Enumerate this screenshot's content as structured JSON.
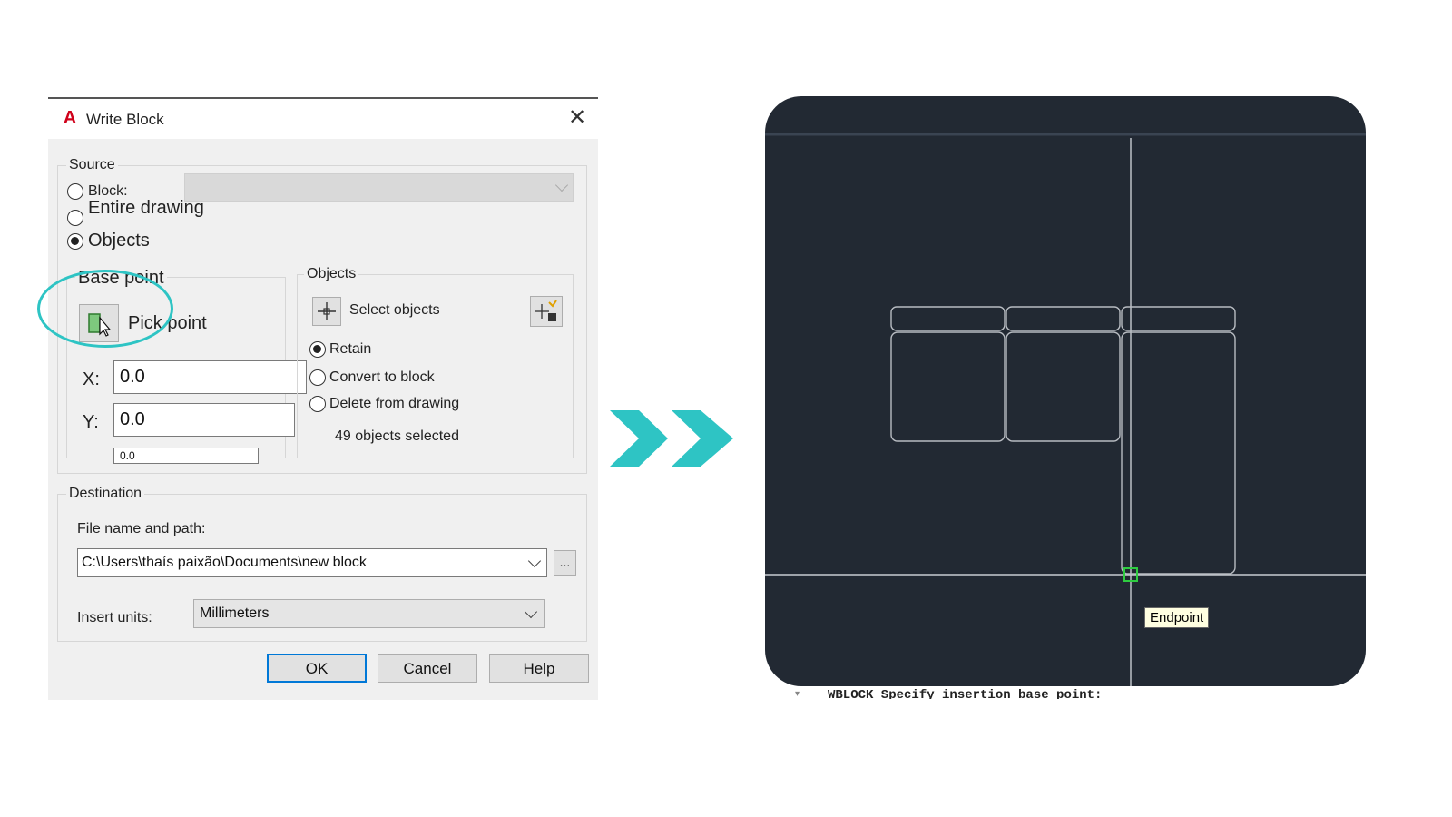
{
  "dialog": {
    "title": "Write Block",
    "close_glyph": "✕",
    "source": {
      "legend": "Source",
      "block_label": "Block:",
      "entire_label": "Entire drawing",
      "objects_label": "Objects",
      "selected": "objects"
    },
    "base_point": {
      "legend": "Base point",
      "pick_label": "Pick point",
      "x_label": "X:",
      "x_value": "0.0",
      "y_label": "Y:",
      "y_value": "0.0",
      "z_value": "0.0"
    },
    "objects": {
      "legend": "Objects",
      "select_label": "Select objects",
      "retain_label": "Retain",
      "convert_label": "Convert to block",
      "delete_label": "Delete from drawing",
      "selected_count": "49 objects selected",
      "selected": "retain"
    },
    "destination": {
      "legend": "Destination",
      "file_label": "File name and path:",
      "file_value": "C:\\Users\\thaís paixão\\Documents\\new block",
      "browse_label": "...",
      "units_label": "Insert units:",
      "units_value": "Millimeters"
    },
    "buttons": {
      "ok": "OK",
      "cancel": "Cancel",
      "help": "Help"
    }
  },
  "canvas": {
    "tooltip": "Endpoint",
    "command_line": "WBLOCK Specify insertion base point:"
  },
  "colors": {
    "accent": "#2ec4c4",
    "canvas_bg": "#222933",
    "snap_marker": "#2ecc40",
    "brand": "#d0021b"
  }
}
